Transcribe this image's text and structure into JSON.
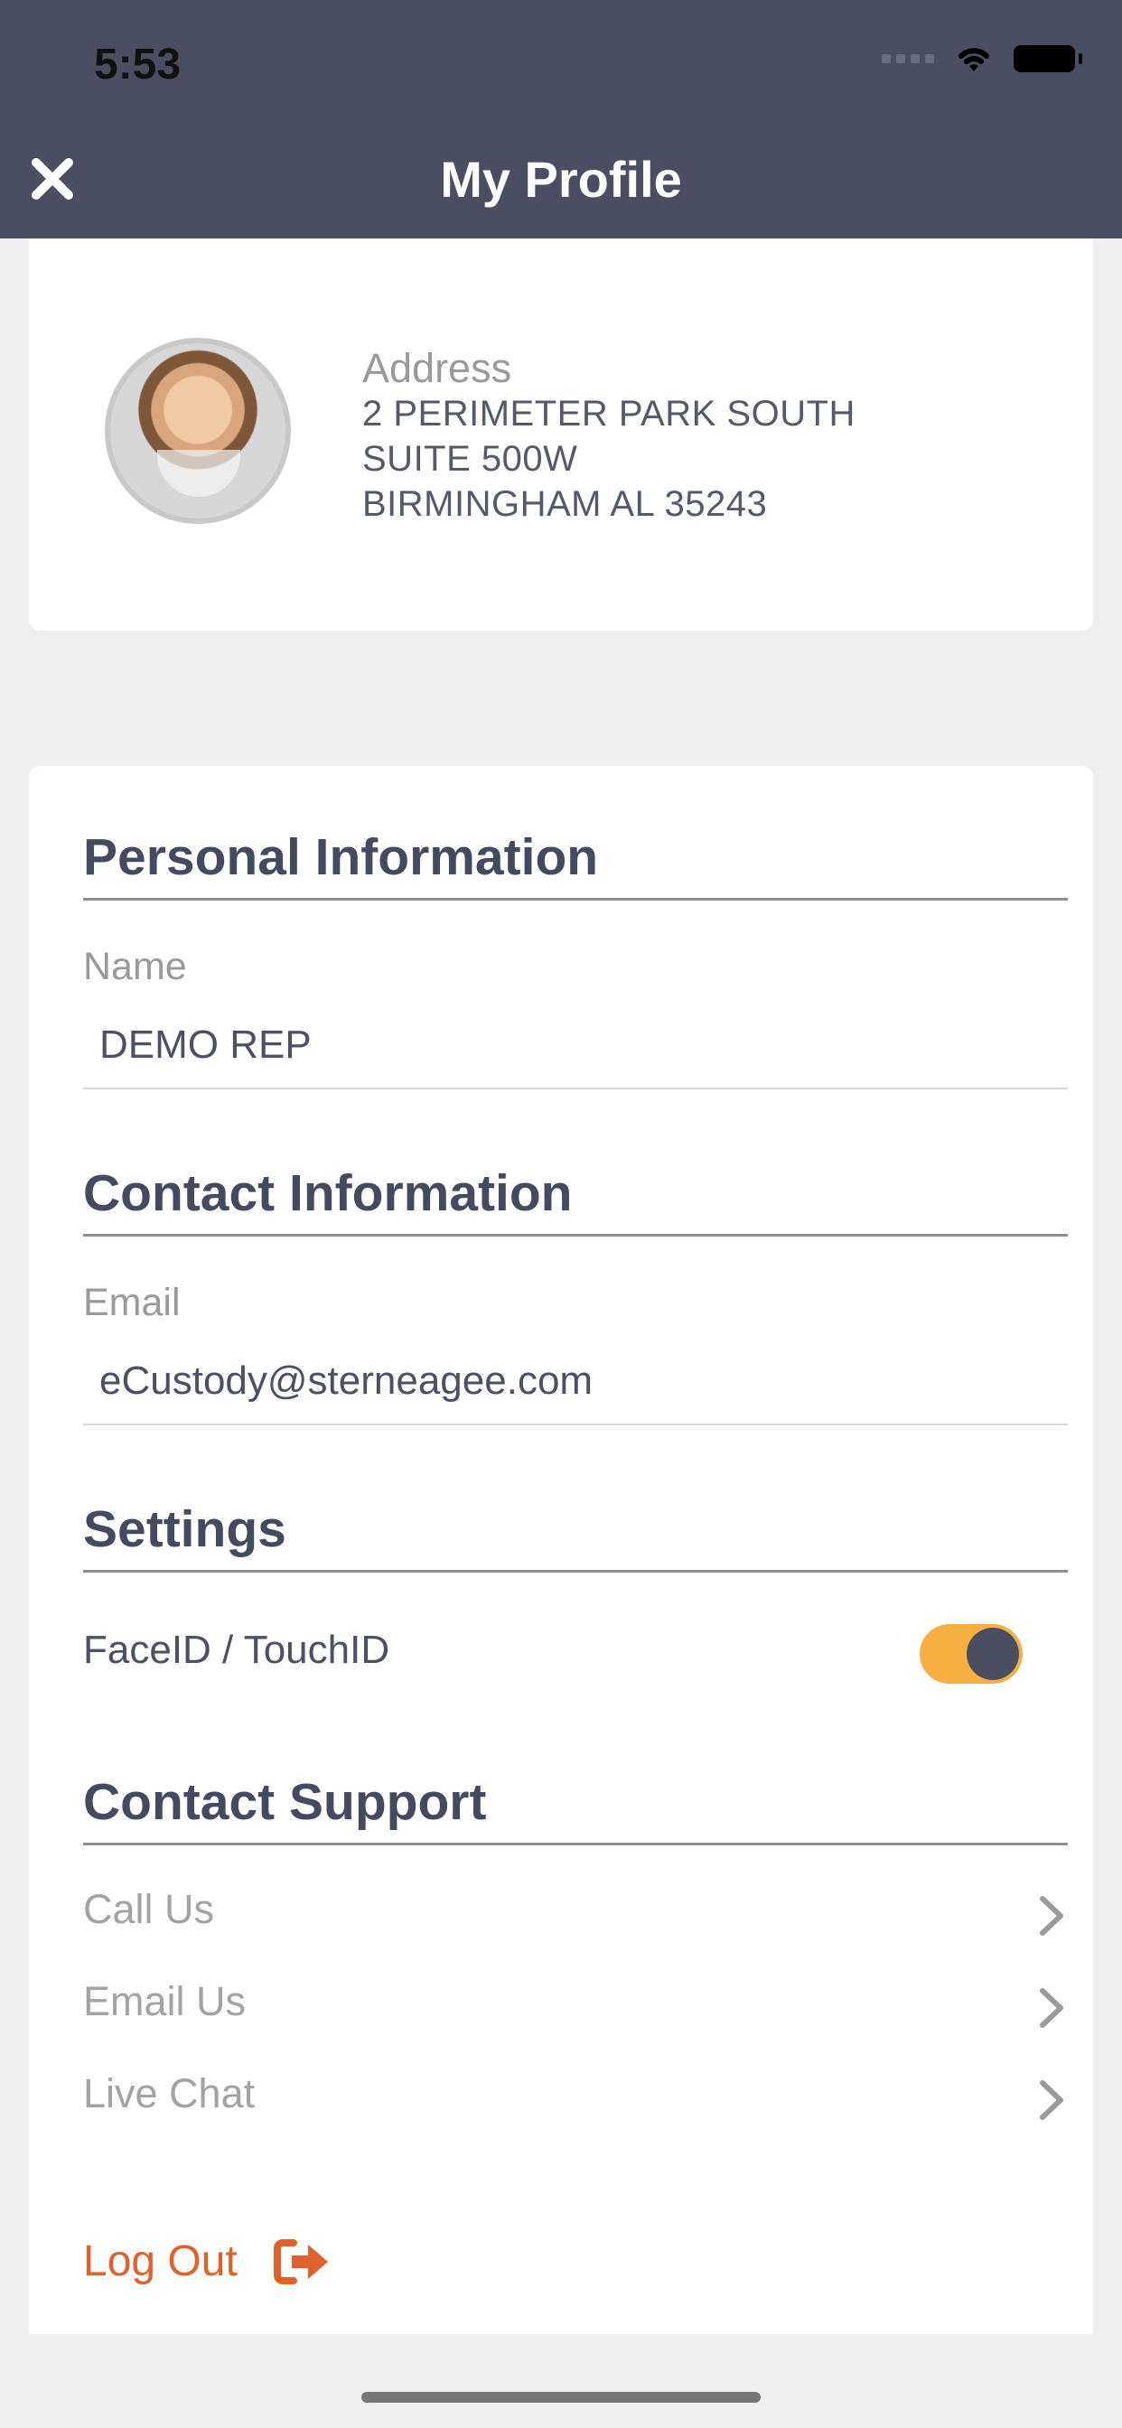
{
  "status_bar": {
    "time": "5:53"
  },
  "header": {
    "title": "My Profile",
    "close_icon": "close-icon"
  },
  "profile": {
    "address_label": "Address",
    "address_lines": [
      "2 PERIMETER PARK SOUTH",
      "SUITE 500W",
      "BIRMINGHAM AL 35243"
    ]
  },
  "personal": {
    "title": "Personal Information",
    "name_label": "Name",
    "name_value": "DEMO REP"
  },
  "contact": {
    "title": "Contact Information",
    "email_label": "Email",
    "email_value": "eCustody@sterneagee.com"
  },
  "settings": {
    "title": "Settings",
    "faceid_label": "FaceID / TouchID",
    "faceid_enabled": true
  },
  "support": {
    "title": "Contact Support",
    "items": [
      {
        "label": "Call Us",
        "icon": "chevron-right-icon"
      },
      {
        "label": "Email Us",
        "icon": "chevron-right-icon"
      },
      {
        "label": "Live Chat",
        "icon": "chevron-right-icon"
      }
    ]
  },
  "logout": {
    "label": "Log Out",
    "icon": "logout-icon"
  },
  "colors": {
    "header": "#4a4e60",
    "toggle_on": "#f6b042",
    "logout": "#e0612a",
    "section_title": "#454b5f"
  }
}
